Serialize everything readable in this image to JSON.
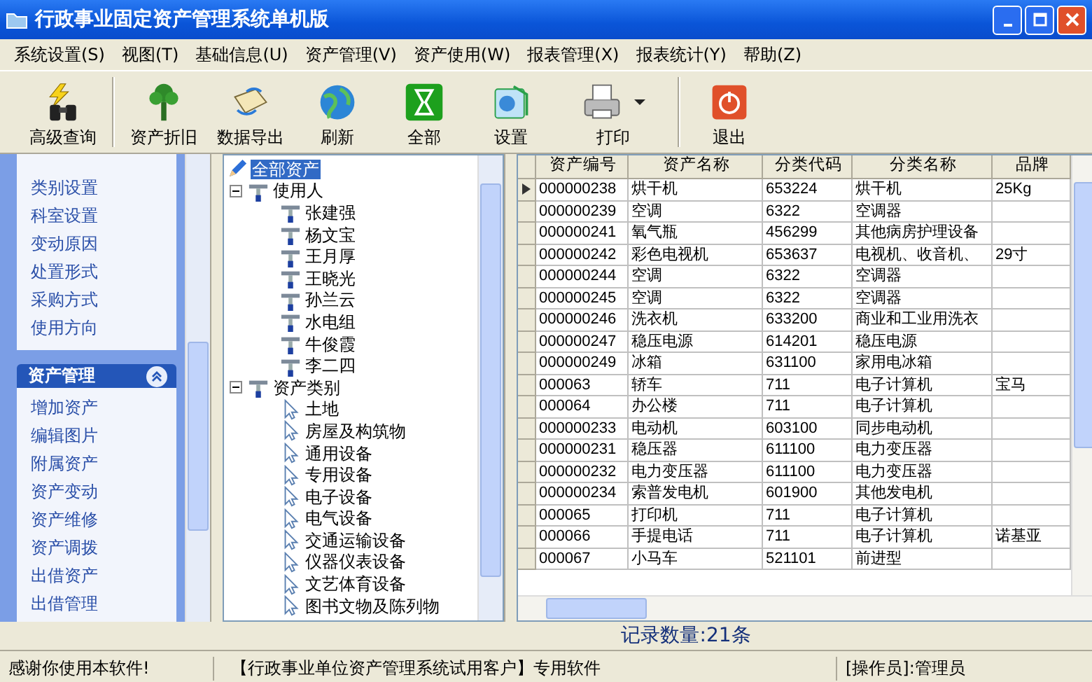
{
  "window": {
    "title": "行政事业固定资产管理系统单机版"
  },
  "menu": [
    "系统设置(S)",
    "视图(T)",
    "基础信息(U)",
    "资产管理(V)",
    "资产使用(W)",
    "报表管理(X)",
    "报表统计(Y)",
    "帮助(Z)"
  ],
  "toolbar": [
    {
      "label": "高级查询",
      "kind": "search"
    },
    {
      "label": "资产折旧",
      "kind": "tree"
    },
    {
      "label": "数据导出",
      "kind": "export"
    },
    {
      "label": "刷新",
      "kind": "refresh"
    },
    {
      "label": "全部",
      "kind": "all"
    },
    {
      "label": "设置",
      "kind": "settings"
    },
    {
      "label": "打印",
      "kind": "print",
      "dropdown": true
    },
    {
      "label": "退出",
      "kind": "exit"
    }
  ],
  "sidebar": {
    "items": [
      "类别设置",
      "科室设置",
      "变动原因",
      "处置形式",
      "采购方式",
      "使用方向"
    ],
    "group": {
      "title": "资产管理",
      "expanded": true,
      "items": [
        "增加资产",
        "编辑图片",
        "附属资产",
        "资产变动",
        "资产维修",
        "资产调拨",
        "出借资产",
        "出借管理"
      ]
    }
  },
  "tree": [
    {
      "label": "全部资产",
      "kind": "root",
      "selected": true,
      "children": [
        {
          "label": "使用人",
          "kind": "group",
          "selected": false,
          "expanded": true,
          "children": [
            {
              "label": "张建强",
              "kind": "user",
              "selected": false
            },
            {
              "label": "杨文宝",
              "kind": "user",
              "selected": false
            },
            {
              "label": "王月厚",
              "kind": "user",
              "selected": false
            },
            {
              "label": "王晓光",
              "kind": "user",
              "selected": false
            },
            {
              "label": "孙兰云",
              "kind": "user",
              "selected": false
            },
            {
              "label": "水电组",
              "kind": "user",
              "selected": false
            },
            {
              "label": "牛俊霞",
              "kind": "user",
              "selected": false
            },
            {
              "label": "李二四",
              "kind": "user",
              "selected": false
            }
          ]
        },
        {
          "label": "资产类别",
          "kind": "group",
          "selected": false,
          "expanded": true,
          "children": [
            {
              "label": "土地",
              "kind": "category",
              "selected": false
            },
            {
              "label": "房屋及构筑物",
              "kind": "category",
              "selected": false
            },
            {
              "label": "通用设备",
              "kind": "category",
              "selected": false
            },
            {
              "label": "专用设备",
              "kind": "category",
              "selected": false
            },
            {
              "label": "电子设备",
              "kind": "category",
              "selected": false
            },
            {
              "label": "电气设备",
              "kind": "category",
              "selected": false
            },
            {
              "label": "交通运输设备",
              "kind": "category",
              "selected": false
            },
            {
              "label": "仪器仪表设备",
              "kind": "category",
              "selected": false
            },
            {
              "label": "文艺体育设备",
              "kind": "category",
              "selected": false
            },
            {
              "label": "图书文物及陈列物",
              "kind": "category",
              "selected": false
            }
          ]
        }
      ]
    }
  ],
  "table": {
    "columns": [
      "资产编号",
      "资产名称",
      "分类代码",
      "分类名称",
      "品牌"
    ],
    "rows": [
      {
        "selected": true,
        "cells": [
          "000000238",
          "烘干机",
          "653224",
          "烘干机",
          "25Kg"
        ]
      },
      {
        "selected": false,
        "cells": [
          "000000239",
          "空调",
          "6322",
          "空调器",
          ""
        ]
      },
      {
        "selected": false,
        "cells": [
          "000000241",
          "氧气瓶",
          "456299",
          "其他病房护理设备",
          ""
        ]
      },
      {
        "selected": false,
        "cells": [
          "000000242",
          "彩色电视机",
          "653637",
          "电视机、收音机、",
          "29寸"
        ]
      },
      {
        "selected": false,
        "cells": [
          "000000244",
          "空调",
          "6322",
          "空调器",
          ""
        ]
      },
      {
        "selected": false,
        "cells": [
          "000000245",
          "空调",
          "6322",
          "空调器",
          ""
        ]
      },
      {
        "selected": false,
        "cells": [
          "000000246",
          "洗衣机",
          "633200",
          "商业和工业用洗衣",
          ""
        ]
      },
      {
        "selected": false,
        "cells": [
          "000000247",
          "稳压电源",
          "614201",
          "稳压电源",
          ""
        ]
      },
      {
        "selected": false,
        "cells": [
          "000000249",
          "冰箱",
          "631100",
          "家用电冰箱",
          ""
        ]
      },
      {
        "selected": false,
        "cells": [
          "000063",
          "轿车",
          "711",
          "电子计算机",
          "宝马"
        ]
      },
      {
        "selected": false,
        "cells": [
          "000064",
          "办公楼",
          "711",
          "电子计算机",
          ""
        ]
      },
      {
        "selected": false,
        "cells": [
          "000000233",
          "电动机",
          "603100",
          "同步电动机",
          ""
        ]
      },
      {
        "selected": false,
        "cells": [
          "000000231",
          "稳压器",
          "611100",
          "电力变压器",
          ""
        ]
      },
      {
        "selected": false,
        "cells": [
          "000000232",
          "电力变压器",
          "611100",
          "电力变压器",
          ""
        ]
      },
      {
        "selected": false,
        "cells": [
          "000000234",
          "索普发电机",
          "601900",
          "其他发电机",
          ""
        ]
      },
      {
        "selected": false,
        "cells": [
          "000065",
          "打印机",
          "711",
          "电子计算机",
          ""
        ]
      },
      {
        "selected": false,
        "cells": [
          "000066",
          "手提电话",
          "711",
          "电子计算机",
          "诺基亚"
        ]
      },
      {
        "selected": false,
        "cells": [
          "000067",
          "小马车",
          "521101",
          "前进型",
          ""
        ]
      }
    ]
  },
  "record_count": "记录数量:21条",
  "status_bar": [
    "感谢你使用本软件!",
    "【行政事业单位资产管理系统试用客户】专用软件",
    "[操作员]:管理员"
  ]
}
